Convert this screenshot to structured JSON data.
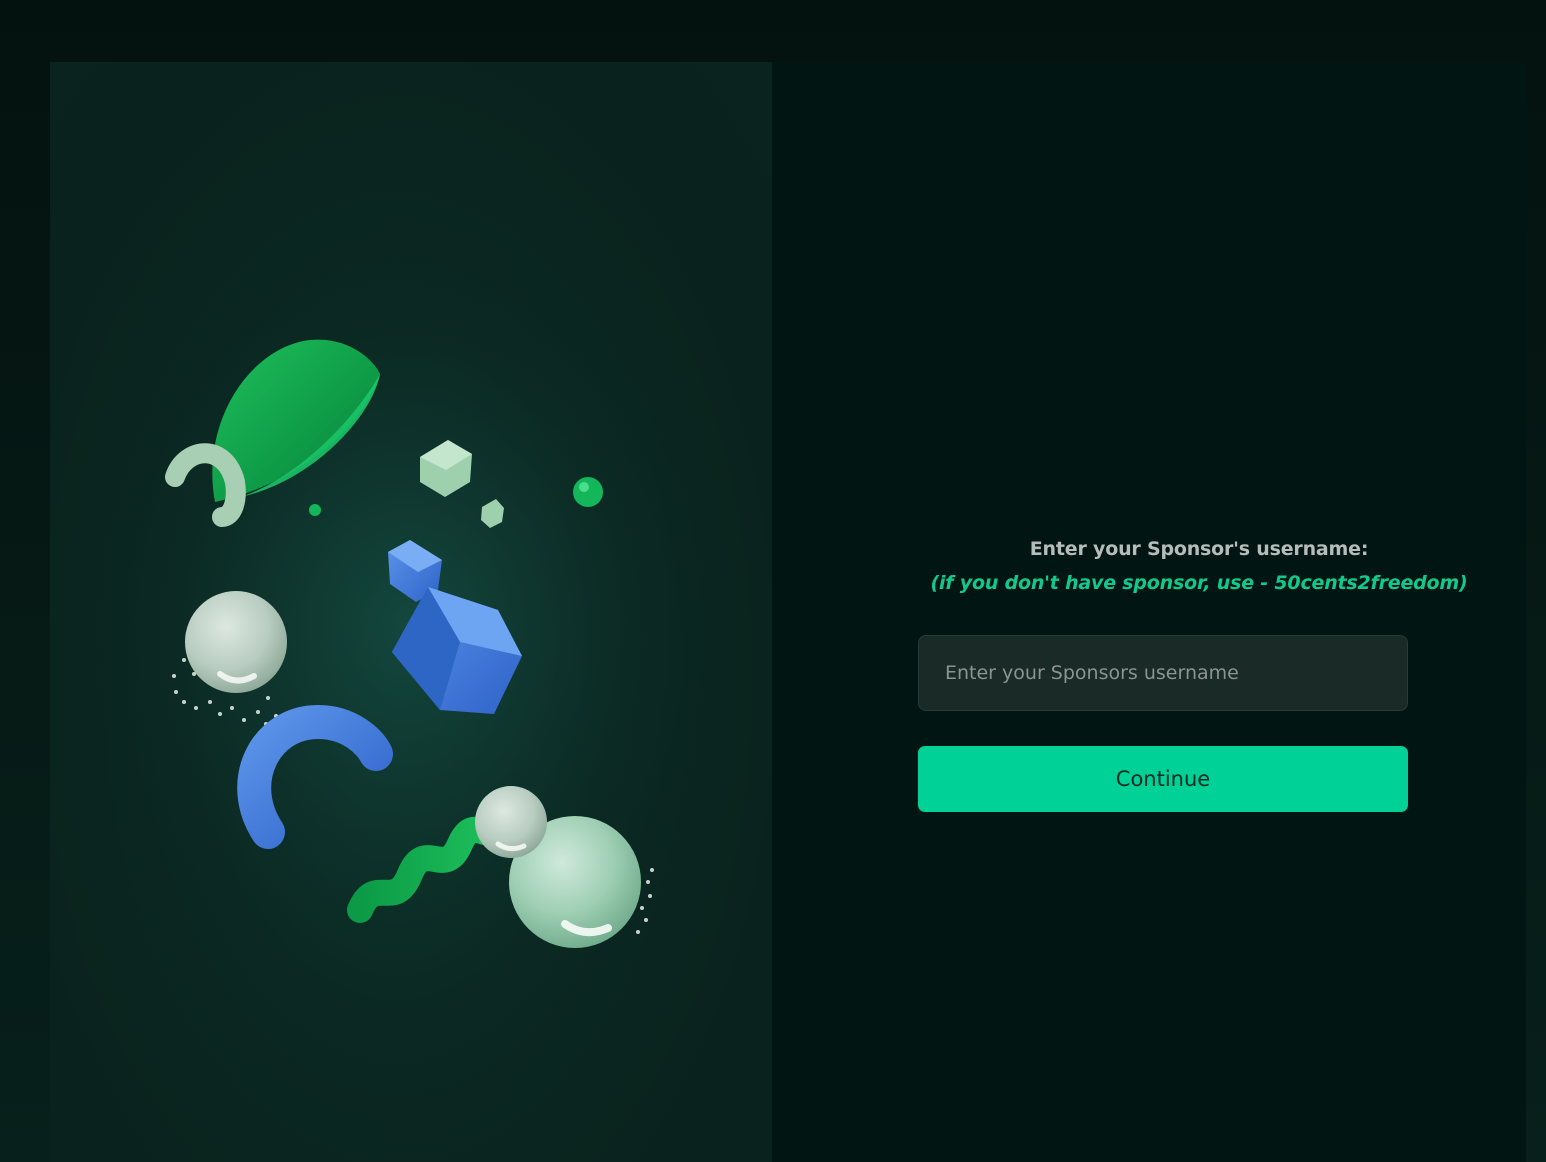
{
  "form": {
    "heading": "Enter your Sponsor's username:",
    "hint": "(if you don't have sponsor, use - 50cents2freedom)",
    "input_placeholder": "Enter your Sponsors username",
    "input_value": "",
    "continue_label": "Continue"
  },
  "illustration": {
    "icon": "abstract-3d-shapes-illustration"
  },
  "colors": {
    "accent": "#00d196",
    "hint_text": "#10c98d",
    "panel_dark": "#011612",
    "panel_art": "#0b2822"
  }
}
